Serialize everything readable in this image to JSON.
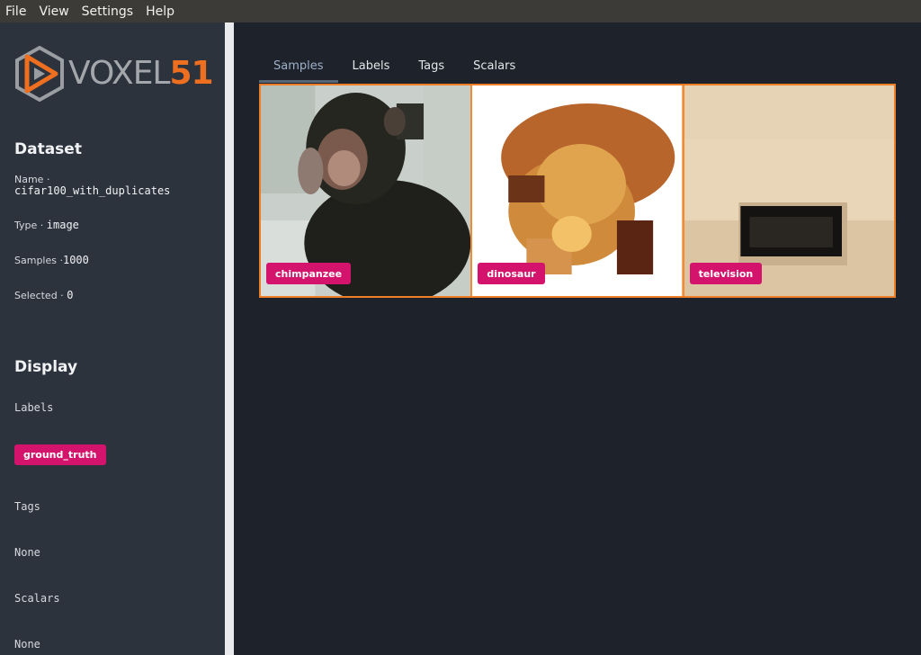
{
  "menu": [
    "File",
    "View",
    "Settings",
    "Help"
  ],
  "logo": {
    "word": "VOXEL",
    "number": "51"
  },
  "dataset": {
    "title": "Dataset",
    "name_label": "Name ·",
    "name_value": "cifar100_with_duplicates",
    "type_label": "Type ·",
    "type_value": "image",
    "samples_label": "Samples ·",
    "samples_value": "1000",
    "selected_label": "Selected ·",
    "selected_value": "0"
  },
  "display": {
    "title": "Display",
    "labels_heading": "Labels",
    "label_chip": "ground_truth",
    "tags_heading": "Tags",
    "tags_value": "None",
    "scalars_heading": "Scalars",
    "scalars_value": "None"
  },
  "tabs": [
    "Samples",
    "Labels",
    "Tags",
    "Scalars"
  ],
  "active_tab": "Samples",
  "samples": [
    {
      "label": "chimpanzee",
      "icon": "chimpanzee-image"
    },
    {
      "label": "dinosaur",
      "icon": "dinosaur-image"
    },
    {
      "label": "television",
      "icon": "television-image"
    }
  ],
  "colors": {
    "accent": "#ee7f27",
    "label_chip": "#d4136d",
    "sidebar": "#2c333d",
    "background": "#1e232b"
  }
}
